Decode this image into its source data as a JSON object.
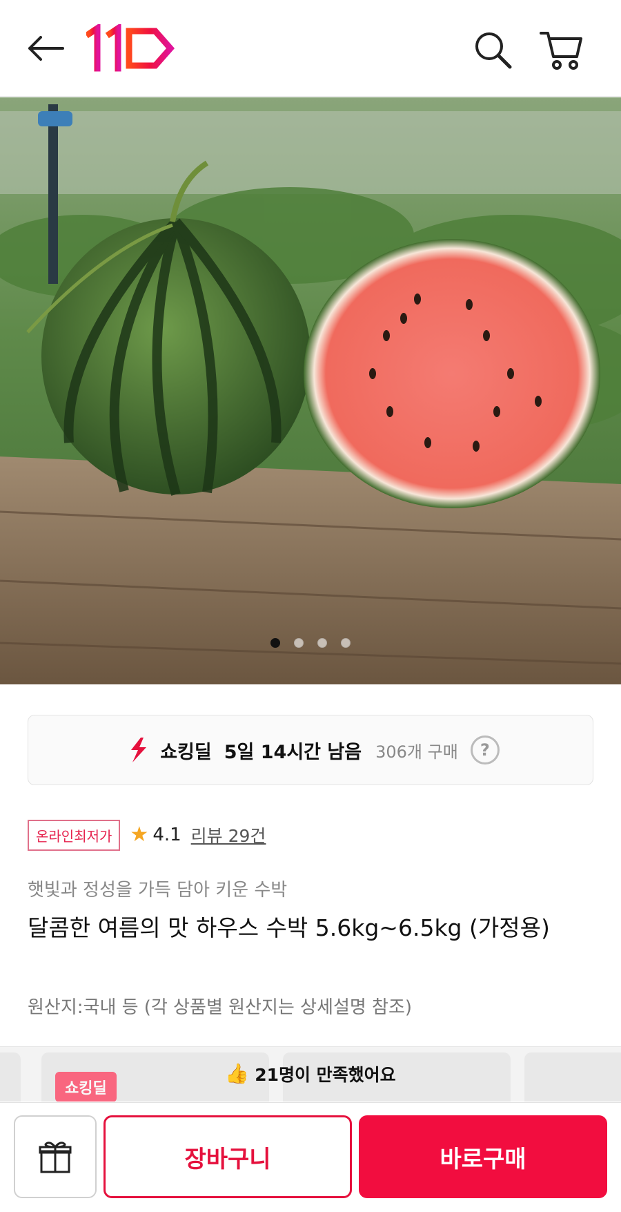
{
  "header": {
    "logo_text": "11",
    "accent_color": "#f0113f"
  },
  "hero": {
    "image_alt": "watermelon",
    "slide_count": 4,
    "active_slide": 1
  },
  "deal": {
    "label": "쇼킹딜",
    "time_left": "5일 14시간 남음",
    "purchase_count": "306개 구매",
    "help_label": "?"
  },
  "product": {
    "badge": "온라인최저가",
    "rating": "4.1",
    "review_link": "리뷰 29건",
    "subtitle": "햇빛과 정성을 가득 담아 키운 수박",
    "title": "달콤한 여름의 맛 하우스 수박 5.6kg~6.5kg (가정용)",
    "origin": "원산지:국내 등 (각 상품별 원산지는 상세설명 참조)"
  },
  "carousel": {
    "thumb_badge": "쇼킹딜",
    "satisfaction": "21명이 만족했어요"
  },
  "bottom_bar": {
    "cart_label": "장바구니",
    "buy_label": "바로구매"
  }
}
